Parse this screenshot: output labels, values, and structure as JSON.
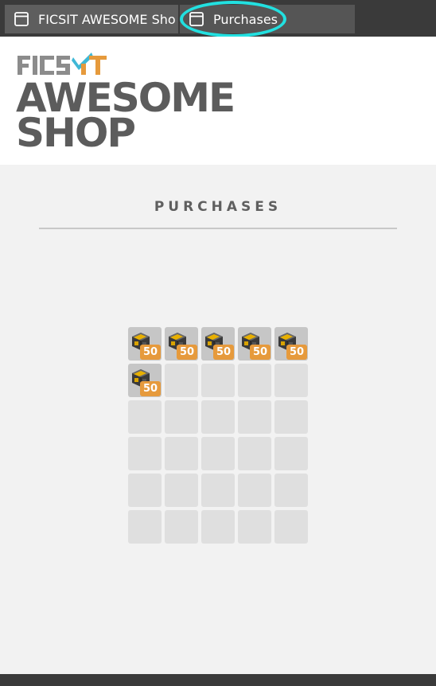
{
  "tabs": [
    {
      "label": "FICSIT AWESOME Sho",
      "icon": "window-icon",
      "active": false
    },
    {
      "label": "Purchases",
      "icon": "window-icon",
      "active": true
    }
  ],
  "logo": {
    "brand": "FICSIT",
    "line1": "AWESOME",
    "line2": "SHOP",
    "text_color": "#5c5c5c",
    "accent_color": "#3fb8d6"
  },
  "page": {
    "title": "PURCHASES"
  },
  "inventory": {
    "columns": 5,
    "rows": 6,
    "slots": [
      {
        "item": "cargo-crate-icon",
        "quantity": "50"
      },
      {
        "item": "cargo-crate-icon",
        "quantity": "50"
      },
      {
        "item": "cargo-crate-icon",
        "quantity": "50"
      },
      {
        "item": "cargo-crate-icon",
        "quantity": "50"
      },
      {
        "item": "cargo-crate-icon",
        "quantity": "50"
      },
      {
        "item": "cargo-crate-icon",
        "quantity": "50"
      },
      null,
      null,
      null,
      null,
      null,
      null,
      null,
      null,
      null,
      null,
      null,
      null,
      null,
      null,
      null,
      null,
      null,
      null,
      null,
      null,
      null,
      null,
      null,
      null
    ]
  },
  "colors": {
    "tabbar": "#3a3a3a",
    "highlight": "#22e0e0",
    "quantity_badge": "#e69a3c",
    "empty_slot": "#dfdfdf",
    "filled_slot": "#c6c6c6"
  }
}
